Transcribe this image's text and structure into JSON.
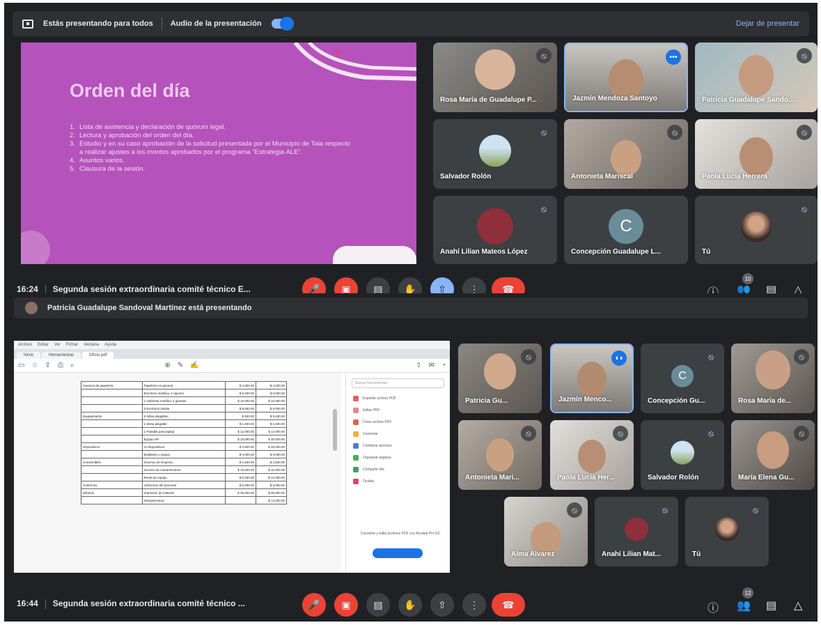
{
  "top": {
    "present_bar": {
      "presenting_text": "Estás presentando para todos",
      "audio_text": "Audio de la presentación",
      "stop_text": "Dejar de presentar"
    },
    "slide": {
      "title": "Orden del día",
      "items": [
        "Lista de asistencia y declaración de quórum legal.",
        "Lectura y aprobación del orden del día.",
        "Estudio y en su caso aprobación de la solicitud presentada por el Municipio de Tala respecto a realizar ajustes a los montos aprobados por el programa \"Estrategia ALE\".",
        "Asuntos varios.",
        "Clausura de la sesión."
      ]
    },
    "participants": [
      {
        "name": "Rosa María de Guadalupe P...",
        "state": "mic-off"
      },
      {
        "name": "Jazmín Mendoza Santoyo",
        "state": "more"
      },
      {
        "name": "Patricia Guadalupe Sando...",
        "state": "mic-off"
      },
      {
        "name": "Salvador Rolón",
        "state": "mic-off"
      },
      {
        "name": "Antonieta Mariscal",
        "state": "mic-off"
      },
      {
        "name": "Paola Lucía Herrera",
        "state": "mic-off"
      },
      {
        "name": "Anahí Lilian Mateos López",
        "state": "mic-off"
      },
      {
        "name": "Concepción Guadalupe L...",
        "state": "mic-off",
        "initial": "C"
      },
      {
        "name": "Tú",
        "state": "mic-off"
      }
    ],
    "controls": {
      "time": "16:24",
      "meeting_title": "Segunda sesión extraordinaria comité técnico E...",
      "people_count": "10"
    }
  },
  "bottom": {
    "banner": "Patricia Guadalupe Sandoval Martínez está presentando",
    "pdf": {
      "menu": [
        "Archivo",
        "Editar",
        "Ver",
        "Firmar",
        "Ventana",
        "Ayuda"
      ],
      "tabs": [
        "Inicio",
        "Herramientas",
        "Oficio.pdf"
      ],
      "panel_search": "Buscar herramientas",
      "tools": [
        "Exportar archivo PDF",
        "Editar PDF",
        "Crear archivo PDF",
        "Comentar",
        "Combinar archivos",
        "Organizar páginas",
        "Compartir link",
        "Ocultar"
      ],
      "promo": "Convierte y edita archivos PDF con Acrobat Pro DC",
      "rows": [
        {
          "a": "Insumos de papelería",
          "b": "Papelería en general",
          "c": "$ 4,000.00",
          "d": "$ 4,000.00"
        },
        {
          "a": "",
          "b": "Escritorio metálico 4 cajones",
          "c": "$ 5,000.00",
          "d": "$ 5,000.00"
        },
        {
          "a": "",
          "b": "1 Gabinete metálico 4 gavetas",
          "c": "$ 10,000.00",
          "d": "$ 10,000.00"
        },
        {
          "a": "",
          "b": "3 Escritorio simple",
          "c": "$ 9,000.00",
          "d": "$ 9,000.00"
        },
        {
          "a": "Equipamiento",
          "b": "6 Sillas plegables",
          "c": "$ 900.00",
          "d": "$ 5,400.00"
        },
        {
          "a": "",
          "b": "1 Mesa plegable",
          "c": "$ 1,500.00",
          "d": "$ 1,500.00"
        },
        {
          "a": "",
          "b": "1 Pantalla para laptop",
          "c": "$ 12,000.00",
          "d": "$ 12,000.00"
        },
        {
          "a": "",
          "b": "Equipo HP",
          "c": "$ 15,000.00",
          "d": "$ 30,000.00"
        },
        {
          "a": "Dispositivos",
          "b": "10 dispositivos",
          "c": "$ 4,500.00",
          "d": "$ 45,000.00"
        },
        {
          "a": "",
          "b": "Mobiliario y equipo",
          "c": "$ 3,000.00",
          "d": "$ 3,000.00"
        },
        {
          "a": "Consumibles",
          "b": "Insumos de limpieza",
          "c": "$ 1,500.00",
          "d": "$ 1,500.00"
        },
        {
          "a": "",
          "b": "Servicio de mantenimiento",
          "c": "$ 10,000.00",
          "d": "$ 10,000.00"
        },
        {
          "a": "",
          "b": "Renta de equipo",
          "c": "$ 6,000.00",
          "d": "$ 12,000.00"
        },
        {
          "a": "Uniformes",
          "b": "Uniformes del personal",
          "c": "$ 5,000.00",
          "d": "$ 5,000.00"
        },
        {
          "a": "Difusión",
          "b": "Impresión de material",
          "c": "$ 35,000.00",
          "d": "$ 35,000.00"
        },
        {
          "a": "",
          "b": "Infraestructura",
          "c": "",
          "d": "$ 13,000.00"
        }
      ]
    },
    "participants": [
      {
        "name": "Patricia Gu...",
        "state": "mic-off"
      },
      {
        "name": "Jazmín Menco...",
        "state": "speaking"
      },
      {
        "name": "Concepción Gu...",
        "state": "mic-off",
        "initial": "C"
      },
      {
        "name": "Rosa María de...",
        "state": "mic-off"
      },
      {
        "name": "Antonieta Mari...",
        "state": "mic-off"
      },
      {
        "name": "Paola Lucía Her...",
        "state": "mic-off"
      },
      {
        "name": "Salvador Rolón",
        "state": "mic-off"
      },
      {
        "name": "María Elena Gu...",
        "state": "mic-off"
      },
      {
        "name": "Alma Alvarez",
        "state": "mic-off"
      },
      {
        "name": "Anahí Lilian Mat...",
        "state": "mic-off"
      },
      {
        "name": "Tú",
        "state": "mic-off"
      }
    ],
    "controls": {
      "time": "16:44",
      "meeting_title": "Segunda sesión extraordinaria comité técnico ...",
      "people_count": "12"
    }
  },
  "colors": {
    "background": "#202124",
    "tile": "#3c4043",
    "slide": "#b552bb",
    "accent": "#8ab4f8",
    "end_call": "#ea4335"
  }
}
